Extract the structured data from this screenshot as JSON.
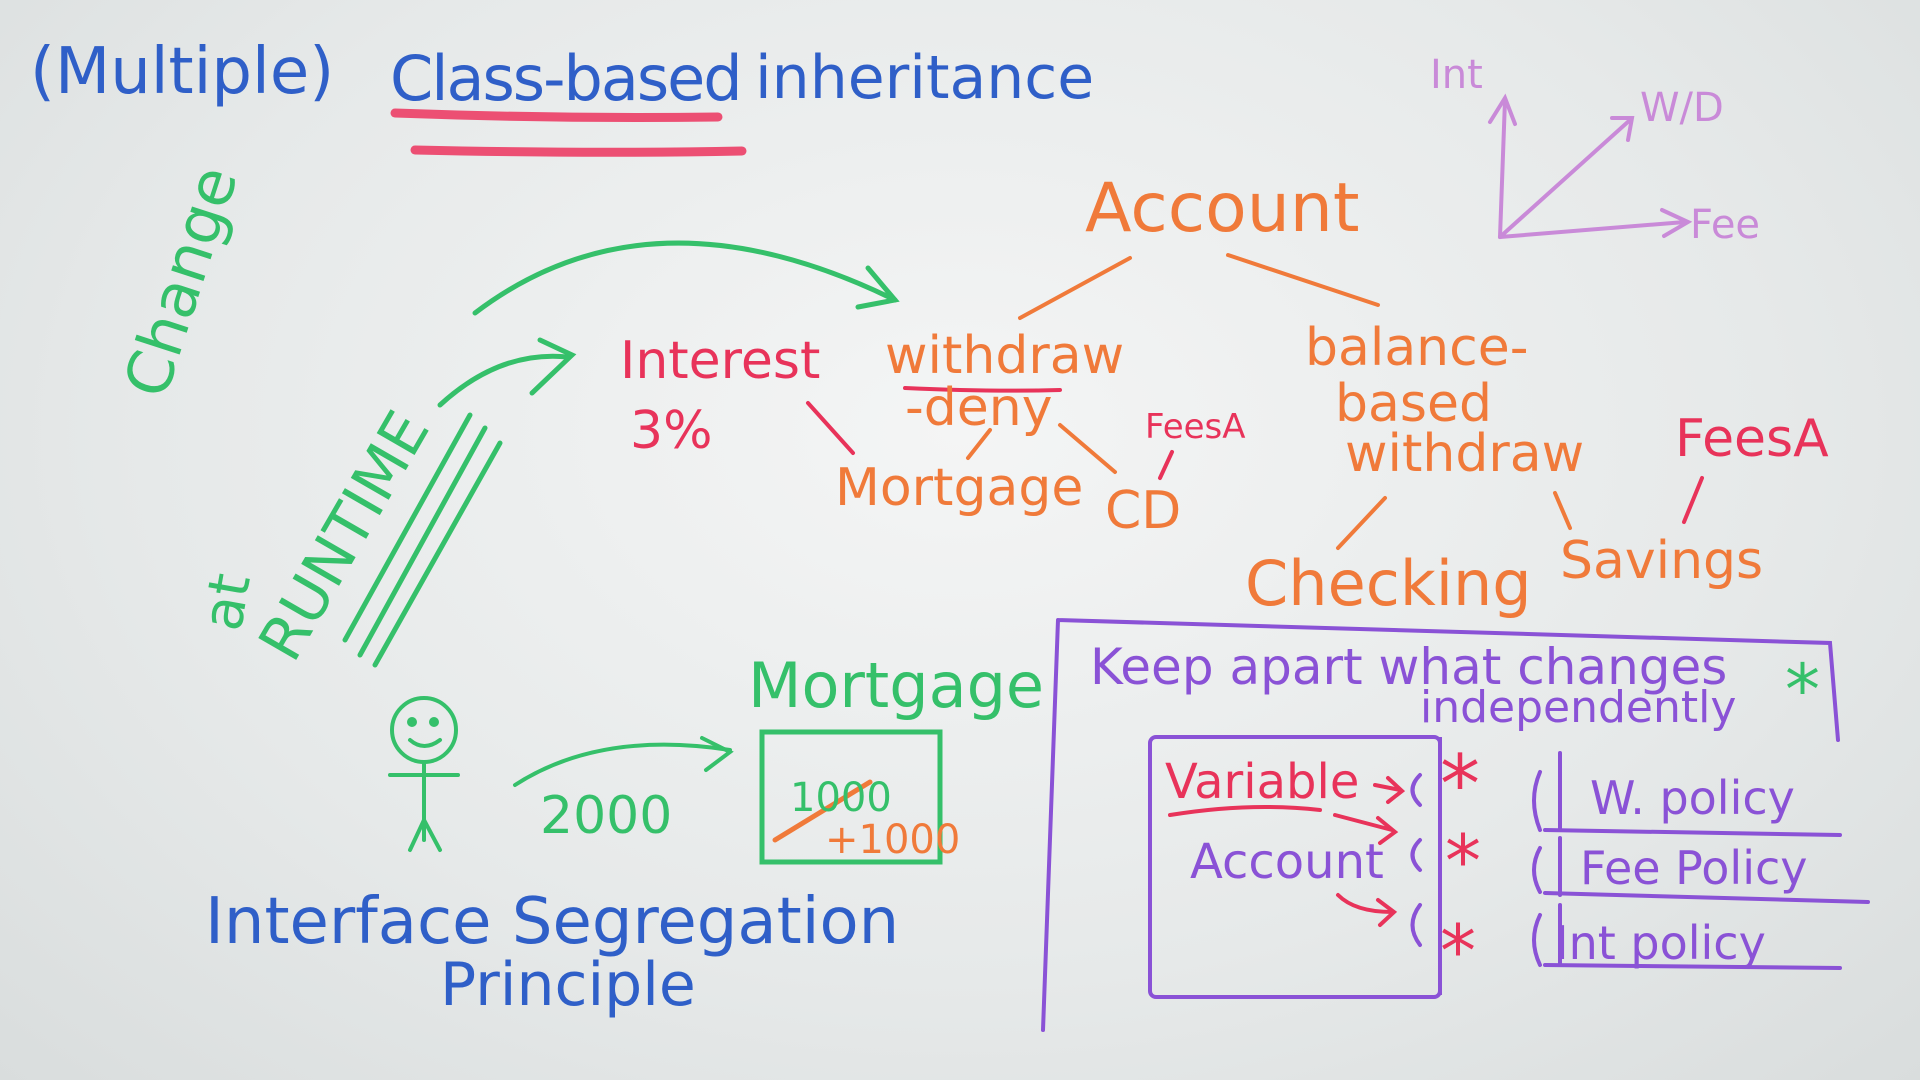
{
  "colors": {
    "blue": "#2f5fc8",
    "orange": "#f07a3a",
    "red": "#e8335a",
    "green": "#35c06a",
    "purple": "#8a52d6",
    "lilac": "#c98ad8"
  },
  "title": {
    "part1": "(Multiple)",
    "part2": "Class-based",
    "part3": "inheritance"
  },
  "axes": {
    "y_label": "Int",
    "diag_label": "W/D",
    "x_label": "Fee"
  },
  "tree": {
    "root": "Account",
    "left_branch": {
      "line1": "withdraw",
      "line2": "-deny"
    },
    "right_branch": {
      "line1": "balance-",
      "line2": "based",
      "line3": "withdraw"
    },
    "mortgage": "Mortgage",
    "cd": "CD",
    "cd_fee": "FeesA",
    "checking": "Checking",
    "savings": "Savings",
    "savings_fee": "FeesA",
    "interest": {
      "line1": "Interest",
      "line2": "3%"
    }
  },
  "runtime": {
    "change": "Change",
    "at": "at",
    "runtime": "RUNTIME"
  },
  "bottom_left": {
    "mortgage": "Mortgage",
    "amount_arrow": "2000",
    "old_value": "1000",
    "new_value": "+1000",
    "principle_line1": "Interface Segregation",
    "principle_line2": "Principle"
  },
  "box": {
    "heading_line1": "Keep apart what changes",
    "heading_line2": "independently",
    "star": "*",
    "inner_line1": "Variable",
    "inner_line2": "Account",
    "policies": [
      "W. policy",
      "Fee Policy",
      "Int policy"
    ]
  }
}
